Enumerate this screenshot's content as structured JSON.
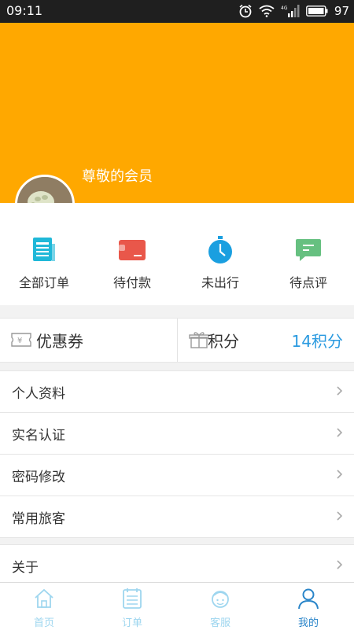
{
  "status_bar": {
    "time": "09:11",
    "battery": "97"
  },
  "header": {
    "member_label": "尊敬的会员"
  },
  "orders": [
    {
      "label": "全部订单",
      "icon": "document-icon",
      "color": "#1fb8d8"
    },
    {
      "label": "待付款",
      "icon": "wallet-icon",
      "color": "#e9574a"
    },
    {
      "label": "未出行",
      "icon": "clock-icon",
      "color": "#1a9fe0"
    },
    {
      "label": "待点评",
      "icon": "chat-icon",
      "color": "#66c080"
    }
  ],
  "coupon": {
    "label": "优惠券",
    "icon": "ticket-icon"
  },
  "points": {
    "label": "积分",
    "icon": "gift-icon",
    "value": "14积分"
  },
  "menu": [
    {
      "label": "个人资料"
    },
    {
      "label": "实名认证"
    },
    {
      "label": "密码修改"
    },
    {
      "label": "常用旅客"
    }
  ],
  "menu2": [
    {
      "label": "关于"
    }
  ],
  "tabs": [
    {
      "label": "首页",
      "icon": "home-icon"
    },
    {
      "label": "订单",
      "icon": "order-list-icon"
    },
    {
      "label": "客服",
      "icon": "customer-service-icon"
    },
    {
      "label": "我的",
      "icon": "profile-icon",
      "active": true
    }
  ],
  "colors": {
    "header": "#ffa800",
    "accent": "#2a9ae0",
    "tab_inactive": "#9ed6ef",
    "tab_active": "#2a85c9"
  }
}
